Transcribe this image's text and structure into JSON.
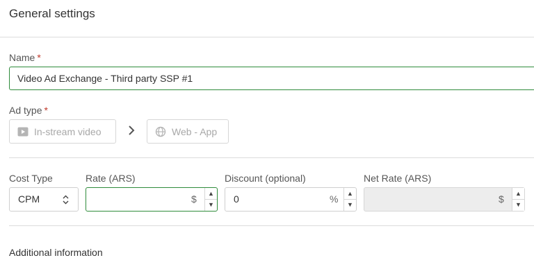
{
  "header": {
    "title": "General settings"
  },
  "name_field": {
    "label": "Name",
    "required_mark": "*",
    "value": "Video Ad Exchange - Third party SSP #1"
  },
  "ad_type": {
    "label": "Ad type",
    "required_mark": "*",
    "chips": [
      {
        "label": "In-stream video",
        "icon": "play-video-icon"
      },
      {
        "label": "Web - App",
        "icon": "globe-icon"
      }
    ],
    "separator_icon": "chevron-right-icon"
  },
  "pricing": {
    "cost_type": {
      "label": "Cost Type",
      "value": "CPM"
    },
    "rate": {
      "label": "Rate (ARS)",
      "value": "",
      "unit": "$"
    },
    "discount": {
      "label": "Discount (optional)",
      "value": "0",
      "unit": "%"
    },
    "net_rate": {
      "label": "Net Rate (ARS)",
      "value": "",
      "unit": "$"
    }
  },
  "additional": {
    "label": "Additional information"
  },
  "colors": {
    "accent": "#2e8b3a",
    "required": "#c0392b",
    "disabled_bg": "#ededed"
  }
}
